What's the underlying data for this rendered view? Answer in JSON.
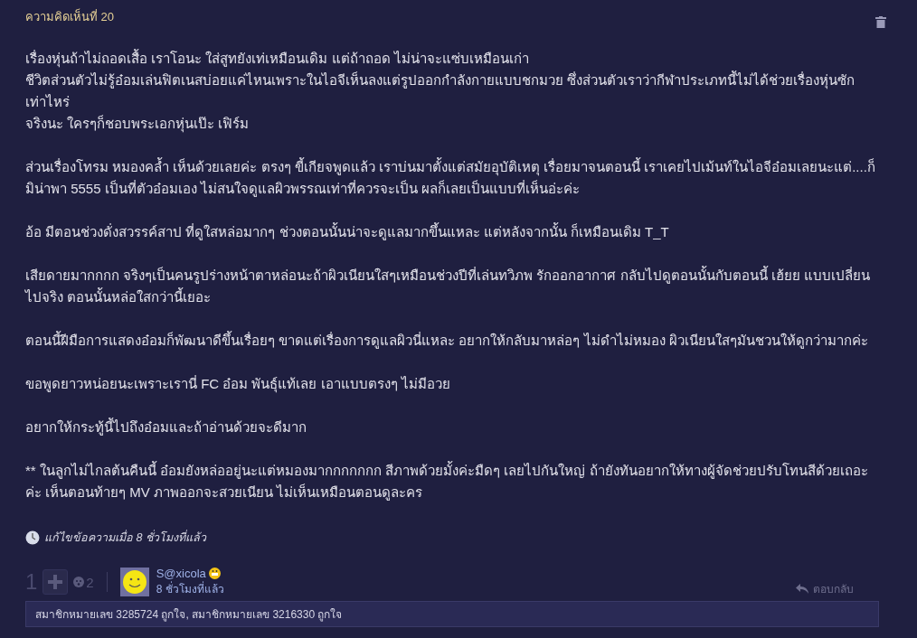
{
  "comment": {
    "title": "ความคิดเห็นที่ 20",
    "paragraphs": [
      [
        "เรื่องหุ่นถ้าไม่ถอดเสื้อ เราโอนะ ใส่สูทยังเท่เหมือนเดิม แต่ถ้าถอด ไม่น่าจะแซ่บเหมือนเก่า",
        "ชีวิตส่วนตัวไม่รู้อ๋อมเล่นฟิตเนสบ่อยแค่ไหนเพราะในไอจีเห็นลงแต่รูปออกกำลังกายแบบชกมวย ซึ่งส่วนตัวเราว่ากีฬาประเภทนี้ไม่ได้ช่วยเรื่องหุ่นซักเท่าไหร่",
        "จริงนะ ใครๆก็ชอบพระเอกหุ่นเป๊ะ เฟิร์ม"
      ],
      [
        "ส่วนเรื่องโทรม หมองคล้ำ เห็นด้วยเลยค่ะ ตรงๆ ขี้เกียจพูดแล้ว เราบ่นมาตั้งแต่สมัยอุบัติเหตุ เรื่อยมาจนตอนนี้  เราเคยไปเม้นท์ในไอจีอ๋อมเลยนะแต่....ก็มิน่าพา 5555 เป็นที่ตัวอ๋อมเอง ไม่สนใจดูแลผิวพรรณเท่าที่ควรจะเป็น ผลก็เลยเป็นแบบที่เห็นอ่ะค่ะ"
      ],
      [
        "อ้อ มีตอนช่วงดั่งสวรรค์สาป ที่ดูใสหล่อมากๆ ช่วงตอนนั้นน่าจะดูแลมากขึ้นแหละ แต่หลังจากนั้น ก็เหมือนเดิม T_T"
      ],
      [
        "เสียดายมากกกก จริงๆเป็นคนรูปร่างหน้าตาหล่อนะถ้าผิวเนียนใสๆเหมือนช่วงปีที่เล่นทวิภพ รักออกอากาศ  กลับไปดูตอนนั้นกับตอนนี้ เฮ้ยย แบบเปลี่ยนไปจริง ตอนนั้นหล่อใสกว่านี้เยอะ"
      ],
      [
        "ตอนนี้ฝีมือการแสดงอ๋อมก็พัฒนาดีขึ้นเรื่อยๆ ขาดแต่เรื่องการดูแลผิวนี่แหละ อยากให้กลับมาหล่อๆ ไม่ดำไม่หมอง ผิวเนียนใสๆมันชวนให้ดูกว่ามากค่ะ"
      ],
      [
        "ขอพูดยาวหน่อยนะเพราะเรานี่ FC อ๋อม พันธุ์แท้เลย เอาแบบตรงๆ ไม่มีอวย"
      ],
      [
        "อยากให้กระทู้นี้ไปถึงอ๋อมและถ้าอ่านด้วยจะดีมาก"
      ],
      [
        "** ในลูกไม่ไกลต้นคืนนี้ อ๋อมยังหล่ออยู่นะแต่หมองมากกกกกกก สีภาพด้วยมั้งค่ะมืดๆ เลยไปกันใหญ่ ถ้ายังทันอยากให้ทางผู้จัดช่วยปรับโทนสีด้วยเถอะค่ะ เห็นตอนท้ายๆ MV ภาพออกจะสวยเนียน ไม่เห็นเหมือนตอนดูละคร"
      ]
    ],
    "edited": "แก้ไขข้อความเมื่อ 8 ชั่วโมงที่แล้ว",
    "votes": "1",
    "emotions": "2",
    "author": {
      "name": "S@xicola",
      "time": "8 ชั่วโมงที่แล้ว"
    },
    "reply": "ตอบกลับ",
    "likes": "สมาชิกหมายเลข 3285724 ถูกใจ, สมาชิกหมายเลข 3216330 ถูกใจ"
  }
}
